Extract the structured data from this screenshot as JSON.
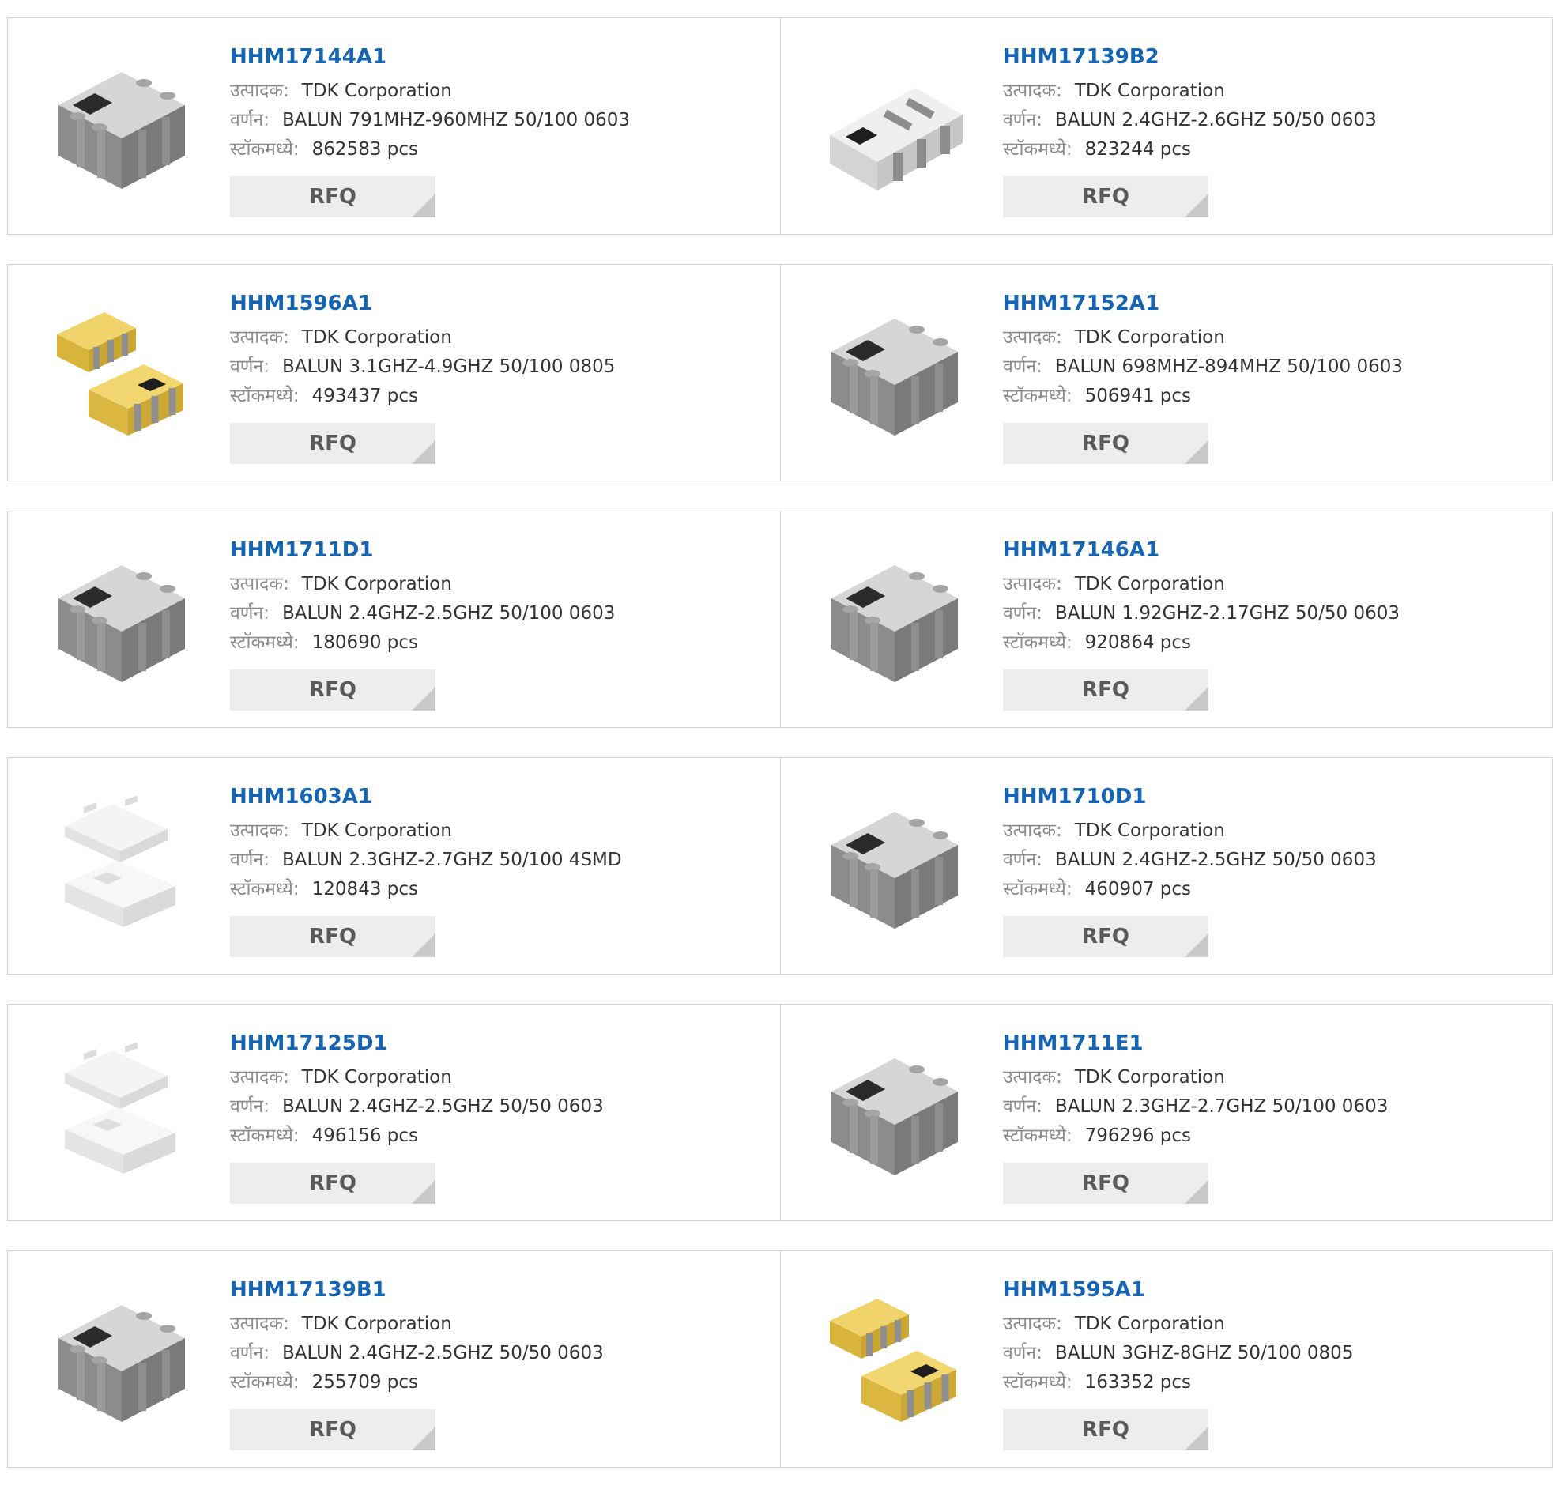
{
  "labels": {
    "manufacturer": "उत्पादक:",
    "description": "वर्णन:",
    "stock": "स्टॉकमध्ये:",
    "rfq": "RFQ"
  },
  "products": [
    {
      "part": "HHM17144A1",
      "manufacturer": "TDK Corporation",
      "description": "BALUN 791MHZ-960MHZ 50/100 0603",
      "stock": "862583 pcs",
      "image": "gray-chip-icon"
    },
    {
      "part": "HHM17139B2",
      "manufacturer": "TDK Corporation",
      "description": "BALUN 2.4GHZ-2.6GHZ 50/50 0603",
      "stock": "823244 pcs",
      "image": "light-chip-icon"
    },
    {
      "part": "HHM1596A1",
      "manufacturer": "TDK Corporation",
      "description": "BALUN 3.1GHZ-4.9GHZ 50/100 0805",
      "stock": "493437 pcs",
      "image": "gold-chip-pair-icon"
    },
    {
      "part": "HHM17152A1",
      "manufacturer": "TDK Corporation",
      "description": "BALUN 698MHZ-894MHZ 50/100 0603",
      "stock": "506941 pcs",
      "image": "gray-chip-icon"
    },
    {
      "part": "HHM1711D1",
      "manufacturer": "TDK Corporation",
      "description": "BALUN 2.4GHZ-2.5GHZ 50/100 0603",
      "stock": "180690 pcs",
      "image": "gray-chip-icon"
    },
    {
      "part": "HHM17146A1",
      "manufacturer": "TDK Corporation",
      "description": "BALUN 1.92GHZ-2.17GHZ 50/50 0603",
      "stock": "920864 pcs",
      "image": "gray-chip-icon"
    },
    {
      "part": "HHM1603A1",
      "manufacturer": "TDK Corporation",
      "description": "BALUN 2.3GHZ-2.7GHZ 50/100 4SMD",
      "stock": "120843 pcs",
      "image": "white-chip-pair-icon"
    },
    {
      "part": "HHM1710D1",
      "manufacturer": "TDK Corporation",
      "description": "BALUN 2.4GHZ-2.5GHZ 50/50 0603",
      "stock": "460907 pcs",
      "image": "gray-chip-icon"
    },
    {
      "part": "HHM17125D1",
      "manufacturer": "TDK Corporation",
      "description": "BALUN 2.4GHZ-2.5GHZ 50/50 0603",
      "stock": "496156 pcs",
      "image": "white-chip-pair-icon"
    },
    {
      "part": "HHM1711E1",
      "manufacturer": "TDK Corporation",
      "description": "BALUN 2.3GHZ-2.7GHZ 50/100 0603",
      "stock": "796296 pcs",
      "image": "gray-chip-icon"
    },
    {
      "part": "HHM17139B1",
      "manufacturer": "TDK Corporation",
      "description": "BALUN 2.4GHZ-2.5GHZ 50/50 0603",
      "stock": "255709 pcs",
      "image": "gray-chip-icon"
    },
    {
      "part": "HHM1595A1",
      "manufacturer": "TDK Corporation",
      "description": "BALUN 3GHZ-8GHZ 50/100 0805",
      "stock": "163352 pcs",
      "image": "gold-chip-pair-icon"
    }
  ]
}
